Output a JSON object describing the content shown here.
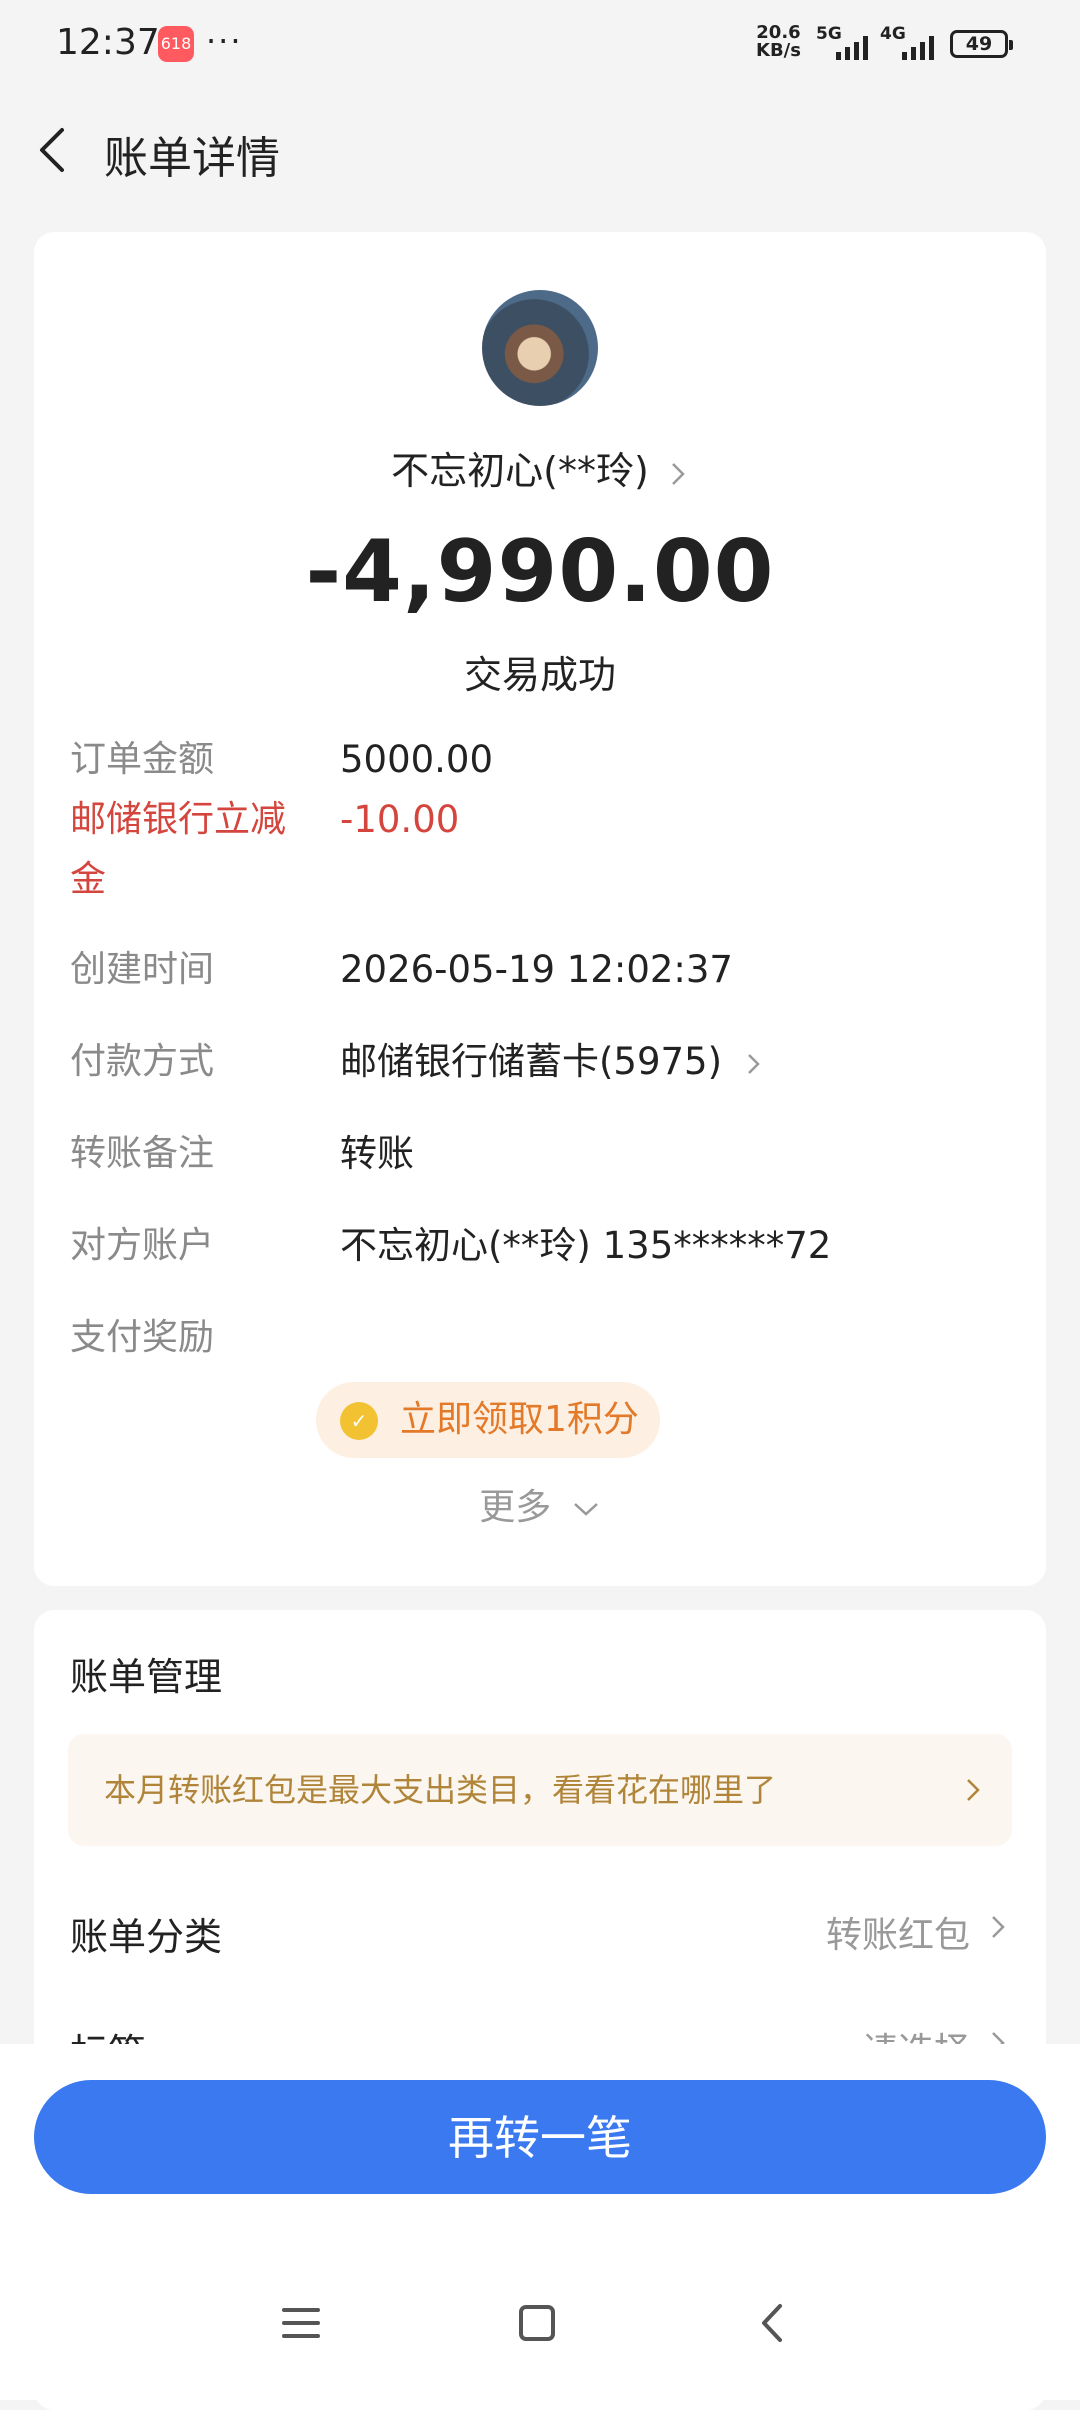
{
  "status_bar": {
    "time": "12:37",
    "app_icon_label": "618",
    "more": "···",
    "net_speed_value": "20.6",
    "net_speed_unit": "KB/s",
    "net_type_1": "5G",
    "net_type_2": "4G",
    "battery": "49"
  },
  "header": {
    "title": "账单详情"
  },
  "summary": {
    "payee": "不忘初心(**玲)",
    "amount": "-4,990.00",
    "status": "交易成功"
  },
  "details": [
    {
      "label": "订单金额",
      "value": "5000.00"
    },
    {
      "label": "邮储银行立减金",
      "value": "-10.00"
    },
    {
      "label": "创建时间",
      "value": "2026-05-19 12:02:37"
    },
    {
      "label": "付款方式",
      "value": "邮储银行储蓄卡(5975)"
    },
    {
      "label": "转账备注",
      "value": "转账"
    },
    {
      "label": "对方账户",
      "value": "不忘初心(**玲) 135******72"
    },
    {
      "label": "支付奖励",
      "value": "立即领取1积分"
    }
  ],
  "more_label": "更多",
  "manage": {
    "title": "账单管理",
    "tip": "本月转账红包是最大支出类目，看看花在哪里了",
    "category_label": "账单分类",
    "category_value": "转账红包",
    "tag_label": "标签",
    "tag_value": "请选择"
  },
  "cta": {
    "label": "再转一笔"
  },
  "colors": {
    "accent": "#3a79f0",
    "discount_red": "#d4463d",
    "reward_orange": "#e37a2a",
    "tip_text": "#b0853a"
  }
}
